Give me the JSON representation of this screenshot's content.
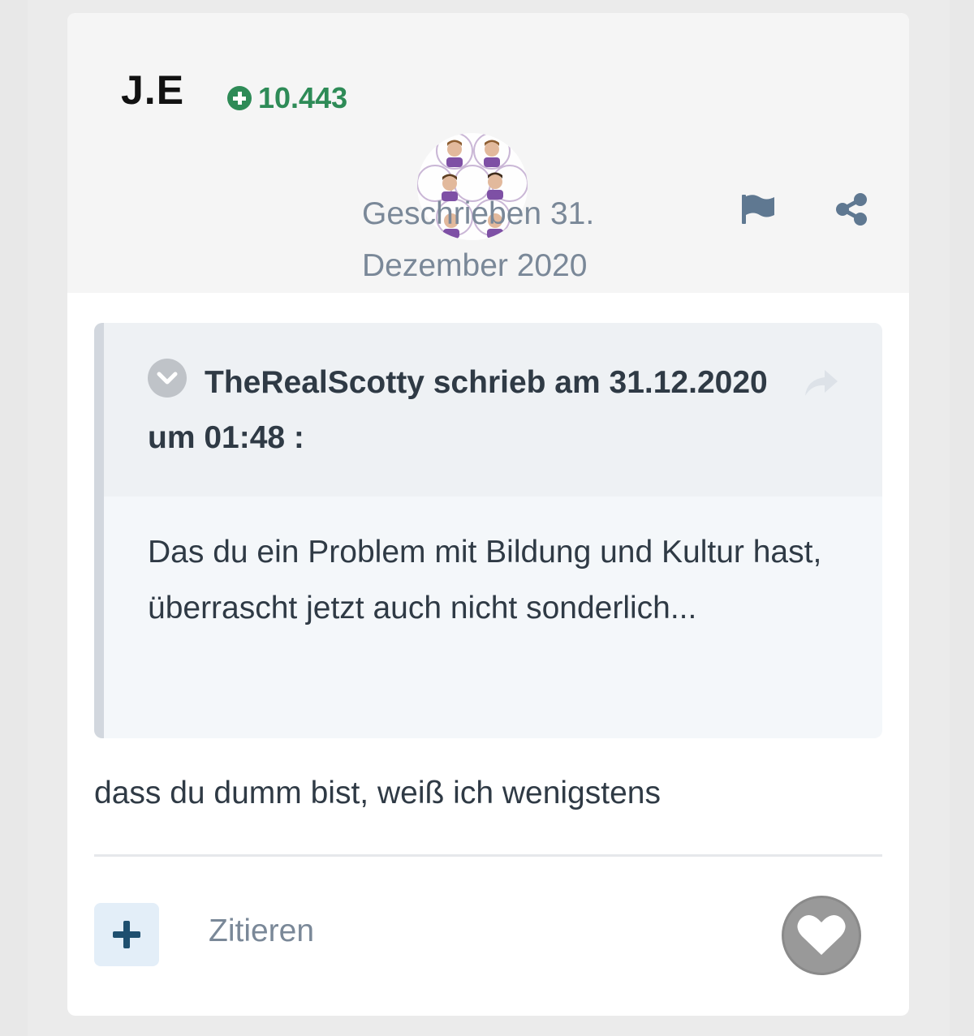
{
  "post": {
    "author": "J.E",
    "reputation": "10.443",
    "date_label": "Geschrieben 31. Dezember 2020",
    "text": "dass du dumm bist, weiß ich wenigstens"
  },
  "quote": {
    "citation": "TheRealScotty schrieb am 31.12.2020 um 01:48 :",
    "body": "Das du ein Problem mit Bildung und Kultur hast, überrascht jetzt auch nicht sonderlich..."
  },
  "actions": {
    "quote_label": "Zitieren"
  },
  "icons": {
    "reputation": "plus-circle-icon",
    "report": "flag-icon",
    "share": "share-icon",
    "quote_toggle": "chevron-down-icon",
    "quote_share": "reply-arrow-icon",
    "multiquote": "plus-icon",
    "like": "heart-icon"
  },
  "colors": {
    "reputation": "#2e8b57",
    "muted_text": "#7a8898",
    "body_text": "#2f3a45",
    "quote_border": "#d2d7de"
  }
}
